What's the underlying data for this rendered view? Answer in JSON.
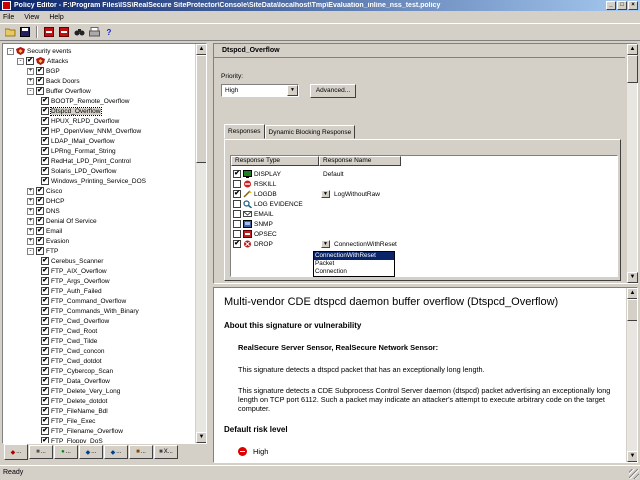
{
  "window": {
    "title": "Policy Editor - F:\\Program Files\\ISS\\RealSecure SiteProtector\\Console\\SiteData\\localhost\\Tmp\\Evaluation_inline_nss_test.policy"
  },
  "menu": [
    "File",
    "View",
    "Help"
  ],
  "toolbar": {
    "icons": [
      "open-icon",
      "save-icon",
      "red-stop-icon",
      "red-stop-icon",
      "binoculars-icon",
      "print-icon",
      "help-icon"
    ],
    "help_glyph": "?"
  },
  "tree": {
    "rows": [
      {
        "label": "Security events",
        "exp": "-",
        "chk": "",
        "icon": "shield"
      },
      {
        "label": "Attacks",
        "exp": "-",
        "chk": "✔",
        "icon": "shield"
      },
      {
        "label": "BGP",
        "exp": "+",
        "chk": "✔",
        "icon": ""
      },
      {
        "label": "Back Doors",
        "exp": "+",
        "chk": "✔",
        "icon": ""
      },
      {
        "label": "Buffer Overflow",
        "exp": "-",
        "chk": "✔",
        "icon": ""
      },
      {
        "label": "BOOTP_Remote_Overflow",
        "exp": "",
        "chk": "✔",
        "icon": ""
      },
      {
        "label": "Dtspcd_Overflow",
        "exp": "",
        "chk": "✔",
        "icon": "",
        "selected": true
      },
      {
        "label": "HPUX_RLPD_Overflow",
        "exp": "",
        "chk": "✔",
        "icon": ""
      },
      {
        "label": "HP_OpenView_NNM_Overflow",
        "exp": "",
        "chk": "✔",
        "icon": ""
      },
      {
        "label": "LDAP_IMail_Overflow",
        "exp": "",
        "chk": "✔",
        "icon": ""
      },
      {
        "label": "LPRng_Format_String",
        "exp": "",
        "chk": "✔",
        "icon": ""
      },
      {
        "label": "RedHat_LPD_Print_Control",
        "exp": "",
        "chk": "✔",
        "icon": ""
      },
      {
        "label": "Solaris_LPD_Overflow",
        "exp": "",
        "chk": "✔",
        "icon": ""
      },
      {
        "label": "Windows_Printing_Service_DOS",
        "exp": "",
        "chk": "✔",
        "icon": ""
      },
      {
        "label": "Cisco",
        "exp": "+",
        "chk": "✔",
        "icon": ""
      },
      {
        "label": "DHCP",
        "exp": "+",
        "chk": "✔",
        "icon": ""
      },
      {
        "label": "DNS",
        "exp": "+",
        "chk": "✔",
        "icon": ""
      },
      {
        "label": "Denial Of Service",
        "exp": "+",
        "chk": "✔",
        "icon": ""
      },
      {
        "label": "Email",
        "exp": "+",
        "chk": "✔",
        "icon": ""
      },
      {
        "label": "Evasion",
        "exp": "+",
        "chk": "✔",
        "icon": ""
      },
      {
        "label": "FTP",
        "exp": "-",
        "chk": "✔",
        "icon": ""
      },
      {
        "label": "Cerebus_Scanner",
        "exp": "",
        "chk": "✔",
        "icon": ""
      },
      {
        "label": "FTP_AIX_Overflow",
        "exp": "",
        "chk": "✔",
        "icon": ""
      },
      {
        "label": "FTP_Args_Overflow",
        "exp": "",
        "chk": "✔",
        "icon": ""
      },
      {
        "label": "FTP_Auth_Failed",
        "exp": "",
        "chk": "✔",
        "icon": ""
      },
      {
        "label": "FTP_Command_Overflow",
        "exp": "",
        "chk": "✔",
        "icon": ""
      },
      {
        "label": "FTP_Commands_With_Binary",
        "exp": "",
        "chk": "✔",
        "icon": ""
      },
      {
        "label": "FTP_Cwd_Overflow",
        "exp": "",
        "chk": "✔",
        "icon": ""
      },
      {
        "label": "FTP_Cwd_Root",
        "exp": "",
        "chk": "✔",
        "icon": ""
      },
      {
        "label": "FTP_Cwd_Tilde",
        "exp": "",
        "chk": "✔",
        "icon": ""
      },
      {
        "label": "FTP_Cwd_concon",
        "exp": "",
        "chk": "✔",
        "icon": ""
      },
      {
        "label": "FTP_Cwd_dotdot",
        "exp": "",
        "chk": "✔",
        "icon": ""
      },
      {
        "label": "FTP_Cybercop_Scan",
        "exp": "",
        "chk": "✔",
        "icon": ""
      },
      {
        "label": "FTP_Data_Overflow",
        "exp": "",
        "chk": "✔",
        "icon": ""
      },
      {
        "label": "FTP_Delete_Very_Long",
        "exp": "",
        "chk": "✔",
        "icon": ""
      },
      {
        "label": "FTP_Delete_dotdot",
        "exp": "",
        "chk": "✔",
        "icon": ""
      },
      {
        "label": "FTP_FileName_Bdl",
        "exp": "",
        "chk": "✔",
        "icon": ""
      },
      {
        "label": "FTP_File_Exec",
        "exp": "",
        "chk": "✔",
        "icon": ""
      },
      {
        "label": "FTP_Filename_Overflow",
        "exp": "",
        "chk": "✔",
        "icon": ""
      },
      {
        "label": "FTP_Floppy_DoS",
        "exp": "",
        "chk": "✔",
        "icon": ""
      }
    ]
  },
  "left_tabs": [
    "...",
    "...",
    "...",
    "...",
    "...",
    "...",
    "X..."
  ],
  "detail": {
    "header": "Dtspcd_Overflow",
    "priority_label": "Priority:",
    "priority_value": "High",
    "advanced_button": "Advanced...",
    "tabs": [
      "Responses",
      "Dynamic Blocking Response"
    ],
    "columns": [
      "Response Type",
      "Response Name"
    ],
    "responses": [
      {
        "type": "DISPLAY",
        "checked": true,
        "icon": "display",
        "name": "Default",
        "has_dd": false
      },
      {
        "type": "RSKILL",
        "checked": false,
        "icon": "rskill",
        "name": "",
        "has_dd": false
      },
      {
        "type": "LOGDB",
        "checked": true,
        "icon": "logdb",
        "name": "LogWithoutRaw",
        "has_dd": true
      },
      {
        "type": "LOG EVIDENCE",
        "checked": false,
        "icon": "evidence",
        "name": "",
        "has_dd": false
      },
      {
        "type": "EMAIL",
        "checked": false,
        "icon": "email",
        "name": "",
        "has_dd": false
      },
      {
        "type": "SNMP",
        "checked": false,
        "icon": "snmp",
        "name": "",
        "has_dd": false
      },
      {
        "type": "OPSEC",
        "checked": false,
        "icon": "opsec",
        "name": "",
        "has_dd": false
      },
      {
        "type": "DROP",
        "checked": true,
        "icon": "drop",
        "name": "ConnectionWithReset",
        "has_dd": true
      }
    ],
    "dropdown_options": [
      "ConnectionWithReset",
      "Packet",
      "Connection"
    ],
    "dropdown_selected": 0
  },
  "doc": {
    "title": "Multi-vendor CDE dtspcd daemon buffer overflow (Dtspcd_Overflow)",
    "section1": "About this signature or vulnerability",
    "products": "RealSecure Server Sensor, RealSecure Network Sensor:",
    "p1": "This signature detects a dtspcd packet that has an exceptionally long length.",
    "p2": "This signature detects a CDE Subprocess Control Server daemon (dtspcd) packet advertising an exceptionally long length on TCP port 6112. Such a packet may indicate an attacker's attempt to execute arbitrary code on the target computer.",
    "section2": "Default risk level",
    "risk": "High"
  },
  "status": "Ready",
  "colors": {
    "title_start": "#0a246a",
    "title_end": "#a6caf0",
    "selection": "#0a246a",
    "risk": "#dd0000"
  }
}
